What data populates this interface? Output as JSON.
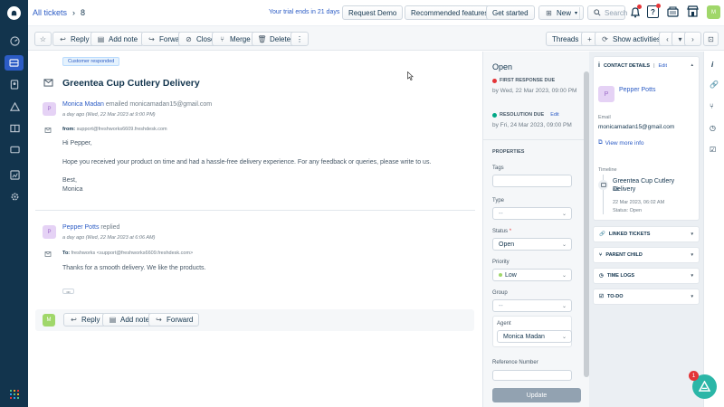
{
  "header": {
    "breadcrumb_link": "All tickets",
    "ticket_number": "8",
    "trial_text": "Your trial ends in 21 days",
    "request_demo": "Request Demo",
    "recommended": "Recommended features",
    "get_started": "Get started",
    "new_label": "New",
    "search_placeholder": "Search",
    "notifications_count": "",
    "user_initials": "M"
  },
  "toolbar": {
    "reply": "Reply",
    "add_note": "Add note",
    "forward": "Forward",
    "close": "Close",
    "merge": "Merge",
    "delete": "Delete",
    "more": "⋮",
    "threads": "Threads",
    "show_activities": "Show activities"
  },
  "conversation": {
    "status_tag": "Customer responded",
    "subject": "Greentea Cup Cutlery Delivery",
    "msg1": {
      "avatar": "P",
      "sender": "Monica Madan",
      "action": "emailed",
      "email": "monicamadan15@gmail.com",
      "time": "a day ago (Wed, 22 Mar 2023 at 9:00 PM)",
      "from_label": "from:",
      "from_value": "support@freshworks6609.freshdesk.com",
      "greeting": "Hi Pepper,",
      "body": "Hope you received your product on time and had a hassle-free delivery experience. For any feedback or queries, please write to us.",
      "closing": "Best,",
      "signature": "Monica"
    },
    "msg2": {
      "avatar": "P",
      "sender": "Pepper Potts",
      "action": "replied",
      "time": "a day ago (Wed, 22 Mar 2023 at 6:06 AM)",
      "to_label": "To:",
      "to_value": "freshworks <support@freshworks6609.freshdesk.com>",
      "body": "Thanks for a smooth delivery. We like the products.",
      "ellipsis": "•••"
    },
    "reply_bar": {
      "avatar": "M",
      "reply": "Reply",
      "add_note": "Add note",
      "forward": "Forward"
    }
  },
  "properties": {
    "status_heading": "Open",
    "first_response_label": "FIRST RESPONSE DUE",
    "first_response_value": "by Wed, 22 Mar 2023, 09:00 PM",
    "resolution_label": "RESOLUTION DUE",
    "resolution_edit": "Edit",
    "resolution_value": "by Fri, 24 Mar 2023, 09:00 PM",
    "section_title": "PROPERTIES",
    "tags_label": "Tags",
    "type_label": "Type",
    "type_value": "--",
    "status_label": "Status",
    "status_value": "Open",
    "priority_label": "Priority",
    "priority_value": "Low",
    "group_label": "Group",
    "group_value": "--",
    "agent_label": "Agent",
    "agent_value": "Monica Madan",
    "reference_label": "Reference Number",
    "update_button": "Update"
  },
  "contact": {
    "title": "CONTACT DETAILS",
    "edit": "Edit",
    "avatar": "P",
    "name": "Pepper Potts",
    "email_label": "Email",
    "email_value": "monicamadan15@gmail.com",
    "view_more": "View more info",
    "timeline_label": "Timeline",
    "timeline_title": "Greentea Cup Cutlery Delivery",
    "timeline_id": "#8",
    "timeline_time": "22 Mar 2023, 06:02 AM",
    "timeline_status": "Status: Open"
  },
  "sections": {
    "linked": "LINKED TICKETS",
    "parent_child": "PARENT CHILD",
    "time_logs": "TIME LOGS",
    "todo": "TO-DO"
  },
  "fab": {
    "badge": "1"
  },
  "colors": {
    "nav": "#12344d",
    "accent": "#2c5cc5",
    "first_response": "#e43538",
    "resolution": "#00a886",
    "low_priority": "#a0d76a"
  }
}
